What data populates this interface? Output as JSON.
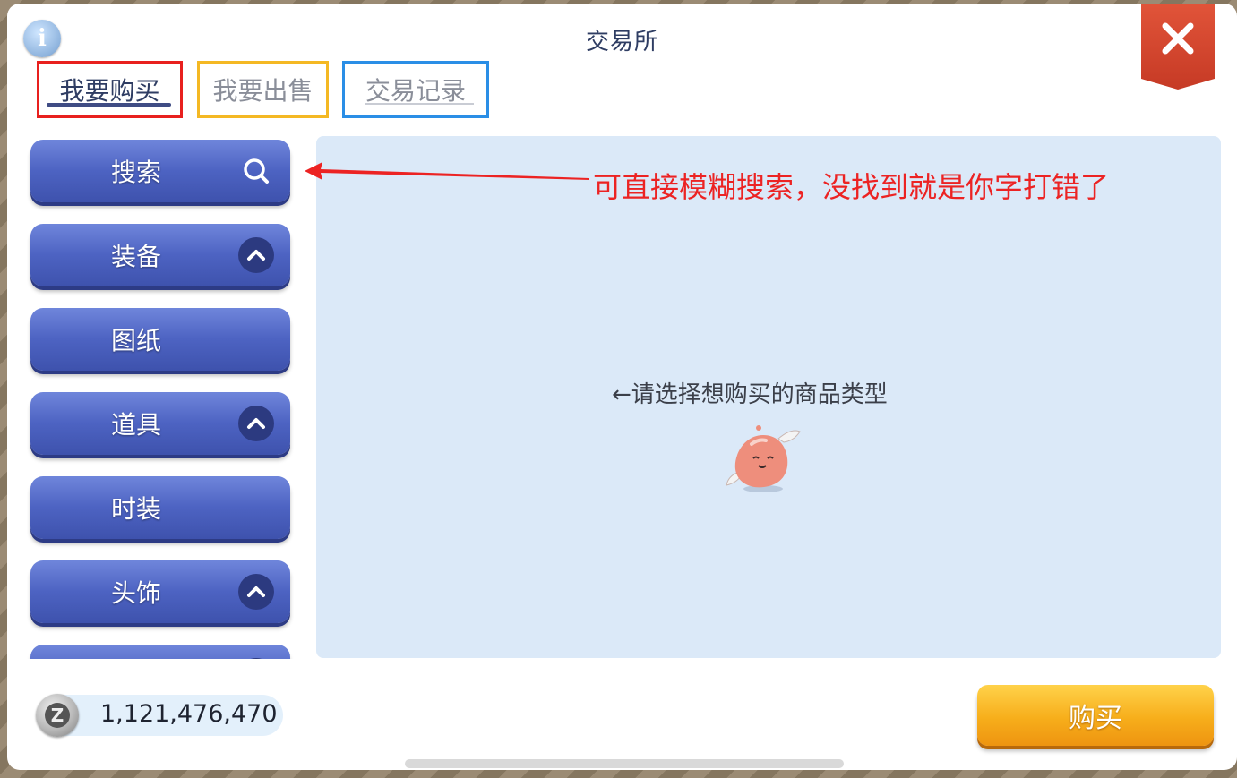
{
  "window": {
    "title": "交易所",
    "info_icon": "i"
  },
  "tabs": [
    {
      "label": "我要购买",
      "active": true,
      "highlight_color": "#e8201e"
    },
    {
      "label": "我要出售",
      "active": false,
      "highlight_color": "#f4b823"
    },
    {
      "label": "交易记录",
      "active": false,
      "highlight_color": "#2a8ee6"
    }
  ],
  "categories": [
    {
      "label": "搜索",
      "icon": "search-icon"
    },
    {
      "label": "装备",
      "icon": "chevron-up-icon"
    },
    {
      "label": "图纸",
      "icon": ""
    },
    {
      "label": "道具",
      "icon": "chevron-up-icon"
    },
    {
      "label": "时装",
      "icon": ""
    },
    {
      "label": "头饰",
      "icon": "chevron-up-icon"
    }
  ],
  "content": {
    "hint": "←请选择想购买的商品类型",
    "mascot": "poring-mascot-icon"
  },
  "annotation": {
    "text": "可直接模糊搜索，没找到就是你字打错了",
    "color": "#ec2323"
  },
  "footer": {
    "zeny_icon": "Z",
    "zeny_amount": "1,121,476,470",
    "buy_label": "购买"
  }
}
